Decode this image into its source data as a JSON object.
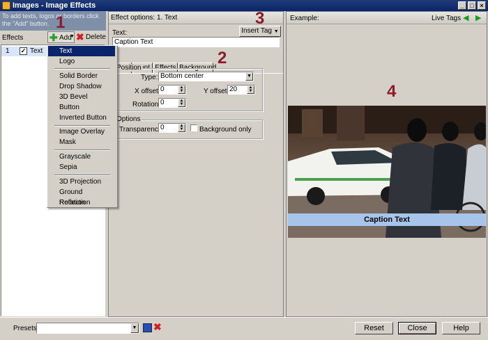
{
  "window": {
    "title": "Images - Image Effects"
  },
  "left": {
    "hint": "To add texts, logos or borders click the \"Add\" button.",
    "effects_label": "Effects",
    "add_label": "Add",
    "delete_label": "Delete",
    "row": {
      "index": "1",
      "name": "Text",
      "checked": true
    }
  },
  "menu": {
    "items": [
      "Text",
      "Logo",
      "Solid Border",
      "Drop Shadow",
      "3D Bevel",
      "Button",
      "Inverted Button",
      "Image Overlay",
      "Mask",
      "Grayscale",
      "Sepia",
      "3D Projection",
      "Ground Reflection",
      "Rotation"
    ],
    "selected": "Text"
  },
  "middle": {
    "header": "Effect options: 1. Text",
    "text_label": "Text:",
    "text_value": "Caption Text",
    "insert_tag_label": "Insert Tag",
    "tabs": [
      "Position",
      "Font",
      "Effects",
      "Background"
    ],
    "tabs_visible": [
      "osition",
      "Font",
      "Effects",
      "Background"
    ],
    "position_group": "Position",
    "type_label": "Type:",
    "type_value": "Bottom center",
    "xoffset_label": "X offset:",
    "xoffset_value": "0",
    "yoffset_label": "Y offset:",
    "yoffset_value": "20",
    "rotation_label": "Rotation:",
    "rotation_value": "0",
    "options_group": "Options",
    "transparency_label": "Transparency:",
    "transparency_value": "0",
    "background_only_label": "Background only"
  },
  "right": {
    "header": "Example:",
    "live_tags_label": "Live Tags",
    "caption": "Caption Text"
  },
  "callouts": [
    "1",
    "2",
    "3",
    "4"
  ],
  "bottom": {
    "presets_label": "Presets:",
    "presets_value": "",
    "reset_label": "Reset",
    "close_label": "Close",
    "help_label": "Help"
  },
  "colors": {
    "title_bar": "#0a246a",
    "menu_highlight": "#0a246a",
    "callout": "#8b1c2a",
    "caption_bar": "#a7c4ea"
  }
}
